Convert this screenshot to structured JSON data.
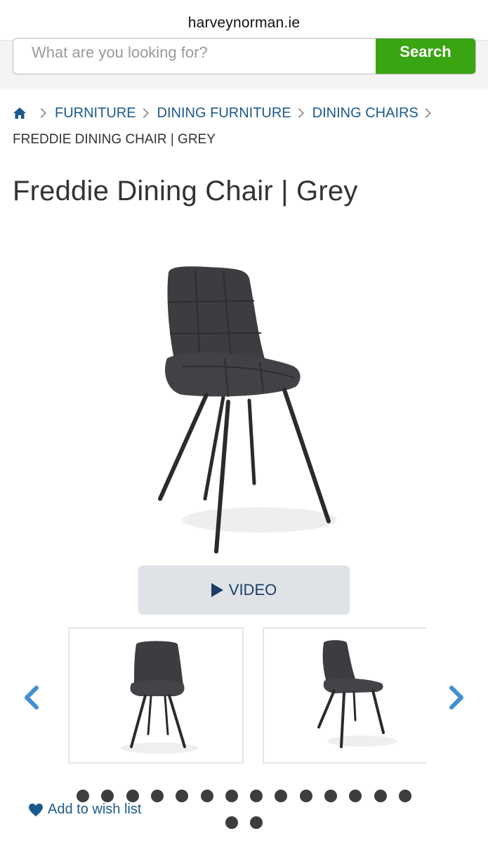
{
  "browser": {
    "url": "harveynorman.ie"
  },
  "search": {
    "placeholder": "What are you looking for?",
    "button_label": "Search"
  },
  "breadcrumb": {
    "home_icon": "home-icon",
    "items": [
      "FURNITURE",
      "DINING FURNITURE",
      "DINING CHAIRS"
    ],
    "current": "FREDDIE DINING CHAIR | GREY"
  },
  "product": {
    "title": "Freddie Dining Chair | Grey"
  },
  "media": {
    "video_label": "VIDEO",
    "video_icon": "play-icon"
  },
  "carousel": {
    "prev_icon": "chevron-left-icon",
    "next_icon": "chevron-right-icon",
    "thumbnail_count_visible": 2
  },
  "pagination": {
    "dot_count": 16
  },
  "wishlist": {
    "label": "Add to wish list",
    "icon": "heart-icon"
  },
  "colors": {
    "link": "#1c5a8c",
    "search_button": "#3aa513",
    "video_button_bg": "#dfe3e8",
    "arrow": "#3f8fd2",
    "chair": "#3b3d40"
  }
}
